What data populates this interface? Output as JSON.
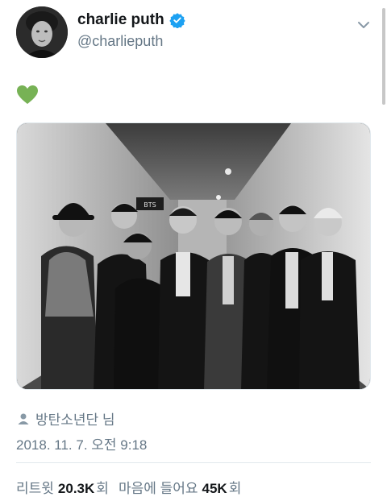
{
  "tweet": {
    "author": {
      "display_name": "charlie puth",
      "handle": "@charlieputh",
      "verified": true,
      "avatar": "profile-photo"
    },
    "text_emoji": "💚",
    "media": {
      "type": "photo",
      "description_icon": "group-photo"
    },
    "tagged_label": "방탄소년단 님",
    "timestamp": "2018. 11. 7. 오전 9:18",
    "stats": {
      "retweets_label": "리트윗",
      "retweets_count": "20.3K",
      "retweets_unit": "회",
      "likes_label": "마음에 들어요",
      "likes_count": "45K",
      "likes_unit": "회"
    }
  },
  "colors": {
    "primary_text": "#14171a",
    "secondary_text": "#657786",
    "verified_blue": "#1da1f2",
    "heart_green": "#77b255",
    "divider": "#e1e8ed"
  }
}
